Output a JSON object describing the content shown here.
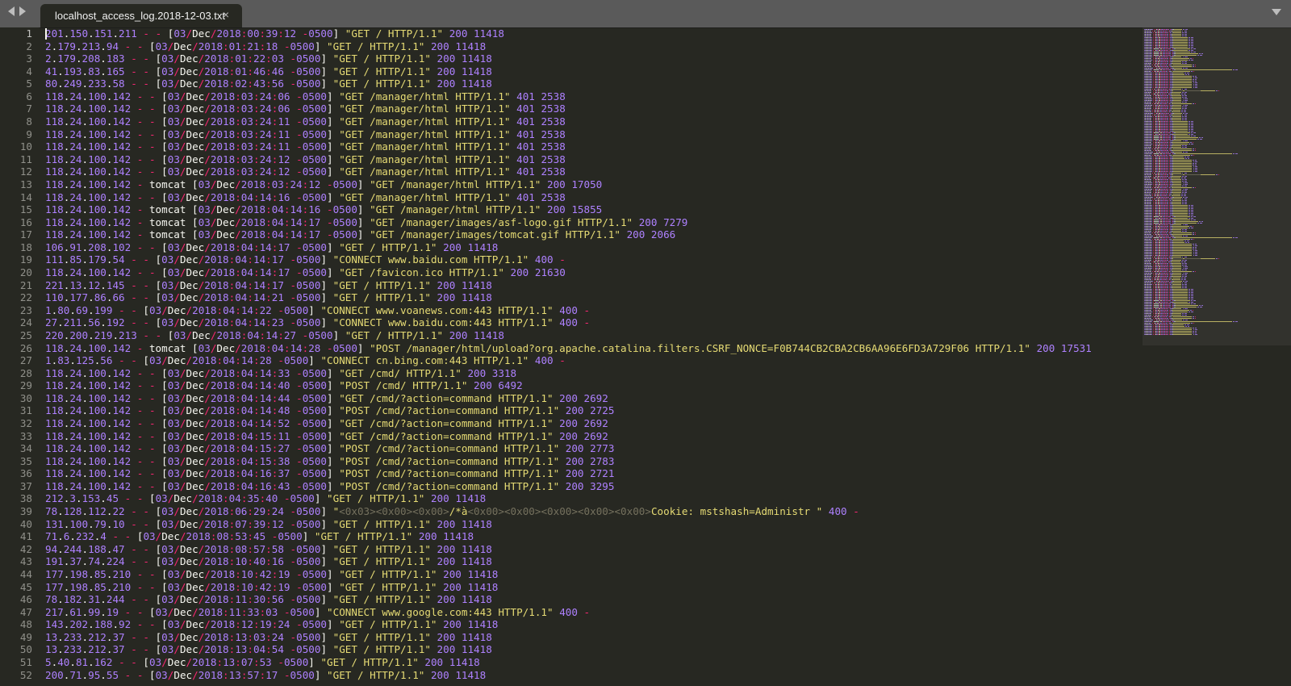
{
  "window": {
    "tab_title": "localhost_access_log.2018-12-03.txt",
    "close_glyph": "×",
    "icons": [
      "chevron-left-icon",
      "chevron-right-icon",
      "close-icon",
      "dropdown-arrow-icon"
    ]
  },
  "editor": {
    "theme_colors": {
      "background": "#272822",
      "number": "#ae81ff",
      "operator": "#f92672",
      "string": "#e6db74",
      "plain": "#f8f8f2",
      "escape": "#75715e",
      "gutter_text": "#90908a"
    },
    "lines": [
      "201.150.151.211 - - [03/Dec/2018:00:39:12 -0500] \"GET / HTTP/1.1\" 200 11418",
      "2.179.213.94 - - [03/Dec/2018:01:21:18 -0500] \"GET / HTTP/1.1\" 200 11418",
      "2.179.208.183 - - [03/Dec/2018:01:22:03 -0500] \"GET / HTTP/1.1\" 200 11418",
      "41.193.83.165 - - [03/Dec/2018:01:46:46 -0500] \"GET / HTTP/1.1\" 200 11418",
      "80.249.233.58 - - [03/Dec/2018:02:43:56 -0500] \"GET / HTTP/1.1\" 200 11418",
      "118.24.100.142 - - [03/Dec/2018:03:24:06 -0500] \"GET /manager/html HTTP/1.1\" 401 2538",
      "118.24.100.142 - - [03/Dec/2018:03:24:06 -0500] \"GET /manager/html HTTP/1.1\" 401 2538",
      "118.24.100.142 - - [03/Dec/2018:03:24:11 -0500] \"GET /manager/html HTTP/1.1\" 401 2538",
      "118.24.100.142 - - [03/Dec/2018:03:24:11 -0500] \"GET /manager/html HTTP/1.1\" 401 2538",
      "118.24.100.142 - - [03/Dec/2018:03:24:11 -0500] \"GET /manager/html HTTP/1.1\" 401 2538",
      "118.24.100.142 - - [03/Dec/2018:03:24:12 -0500] \"GET /manager/html HTTP/1.1\" 401 2538",
      "118.24.100.142 - - [03/Dec/2018:03:24:12 -0500] \"GET /manager/html HTTP/1.1\" 401 2538",
      "118.24.100.142 - tomcat [03/Dec/2018:03:24:12 -0500] \"GET /manager/html HTTP/1.1\" 200 17050",
      "118.24.100.142 - - [03/Dec/2018:04:14:16 -0500] \"GET /manager/html HTTP/1.1\" 401 2538",
      "118.24.100.142 - tomcat [03/Dec/2018:04:14:16 -0500] \"GET /manager/html HTTP/1.1\" 200 15855",
      "118.24.100.142 - tomcat [03/Dec/2018:04:14:17 -0500] \"GET /manager/images/asf-logo.gif HTTP/1.1\" 200 7279",
      "118.24.100.142 - tomcat [03/Dec/2018:04:14:17 -0500] \"GET /manager/images/tomcat.gif HTTP/1.1\" 200 2066",
      "106.91.208.102 - - [03/Dec/2018:04:14:17 -0500] \"GET / HTTP/1.1\" 200 11418",
      "111.85.179.54 - - [03/Dec/2018:04:14:17 -0500] \"CONNECT www.baidu.com HTTP/1.1\" 400 -",
      "118.24.100.142 - - [03/Dec/2018:04:14:17 -0500] \"GET /favicon.ico HTTP/1.1\" 200 21630",
      "221.13.12.145 - - [03/Dec/2018:04:14:17 -0500] \"GET / HTTP/1.1\" 200 11418",
      "110.177.86.66 - - [03/Dec/2018:04:14:21 -0500] \"GET / HTTP/1.1\" 200 11418",
      "1.80.69.199 - - [03/Dec/2018:04:14:22 -0500] \"CONNECT www.voanews.com:443 HTTP/1.1\" 400 -",
      "27.211.56.192 - - [03/Dec/2018:04:14:23 -0500] \"CONNECT www.baidu.com:443 HTTP/1.1\" 400 -",
      "220.200.219.213 - - [03/Dec/2018:04:14:27 -0500] \"GET / HTTP/1.1\" 200 11418",
      "118.24.100.142 - tomcat [03/Dec/2018:04:14:28 -0500] \"POST /manager/html/upload?org.apache.catalina.filters.CSRF_NONCE=F0B744CB2CBA2CB6AA96E6FD3A729F06 HTTP/1.1\" 200 17531",
      "1.83.125.56 - - [03/Dec/2018:04:14:28 -0500] \"CONNECT cn.bing.com:443 HTTP/1.1\" 400 -",
      "118.24.100.142 - - [03/Dec/2018:04:14:33 -0500] \"GET /cmd/ HTTP/1.1\" 200 3318",
      "118.24.100.142 - - [03/Dec/2018:04:14:40 -0500] \"POST /cmd/ HTTP/1.1\" 200 6492",
      "118.24.100.142 - - [03/Dec/2018:04:14:44 -0500] \"GET /cmd/?action=command HTTP/1.1\" 200 2692",
      "118.24.100.142 - - [03/Dec/2018:04:14:48 -0500] \"POST /cmd/?action=command HTTP/1.1\" 200 2725",
      "118.24.100.142 - - [03/Dec/2018:04:14:52 -0500] \"GET /cmd/?action=command HTTP/1.1\" 200 2692",
      "118.24.100.142 - - [03/Dec/2018:04:15:11 -0500] \"GET /cmd/?action=command HTTP/1.1\" 200 2692",
      "118.24.100.142 - - [03/Dec/2018:04:15:27 -0500] \"POST /cmd/?action=command HTTP/1.1\" 200 2773",
      "118.24.100.142 - - [03/Dec/2018:04:15:38 -0500] \"POST /cmd/?action=command HTTP/1.1\" 200 2783",
      "118.24.100.142 - - [03/Dec/2018:04:16:37 -0500] \"POST /cmd/?action=command HTTP/1.1\" 200 2721",
      "118.24.100.142 - - [03/Dec/2018:04:16:43 -0500] \"POST /cmd/?action=command HTTP/1.1\" 200 3295",
      "212.3.153.45 - - [03/Dec/2018:04:35:40 -0500] \"GET / HTTP/1.1\" 200 11418",
      "78.128.112.22 - - [03/Dec/2018:06:29:24 -0500] \"<0x03><0x00><0x00>/*à<0x00><0x00><0x00><0x00><0x00>Cookie: mstshash=Administr \" 400 -",
      "131.100.79.10 - - [03/Dec/2018:07:39:12 -0500] \"GET / HTTP/1.1\" 200 11418",
      "71.6.232.4 - - [03/Dec/2018:08:53:45 -0500] \"GET / HTTP/1.1\" 200 11418",
      "94.244.188.47 - - [03/Dec/2018:08:57:58 -0500] \"GET / HTTP/1.1\" 200 11418",
      "191.37.74.224 - - [03/Dec/2018:10:40:16 -0500] \"GET / HTTP/1.1\" 200 11418",
      "177.198.85.210 - - [03/Dec/2018:10:42:19 -0500] \"GET / HTTP/1.1\" 200 11418",
      "177.198.85.210 - - [03/Dec/2018:10:42:19 -0500] \"GET / HTTP/1.1\" 200 11418",
      "78.182.31.244 - - [03/Dec/2018:11:30:56 -0500] \"GET / HTTP/1.1\" 200 11418",
      "217.61.99.19 - - [03/Dec/2018:11:33:03 -0500] \"CONNECT www.google.com:443 HTTP/1.1\" 400 -",
      "143.202.188.92 - - [03/Dec/2018:12:19:24 -0500] \"GET / HTTP/1.1\" 200 11418",
      "13.233.212.37 - - [03/Dec/2018:13:03:24 -0500] \"GET / HTTP/1.1\" 200 11418",
      "13.233.212.37 - - [03/Dec/2018:13:04:54 -0500] \"GET / HTTP/1.1\" 200 11418",
      "5.40.81.162 - - [03/Dec/2018:13:07:53 -0500] \"GET / HTTP/1.1\" 200 11418",
      "200.71.95.55 - - [03/Dec/2018:13:57:17 -0500] \"GET / HTTP/1.1\" 200 11418"
    ]
  }
}
